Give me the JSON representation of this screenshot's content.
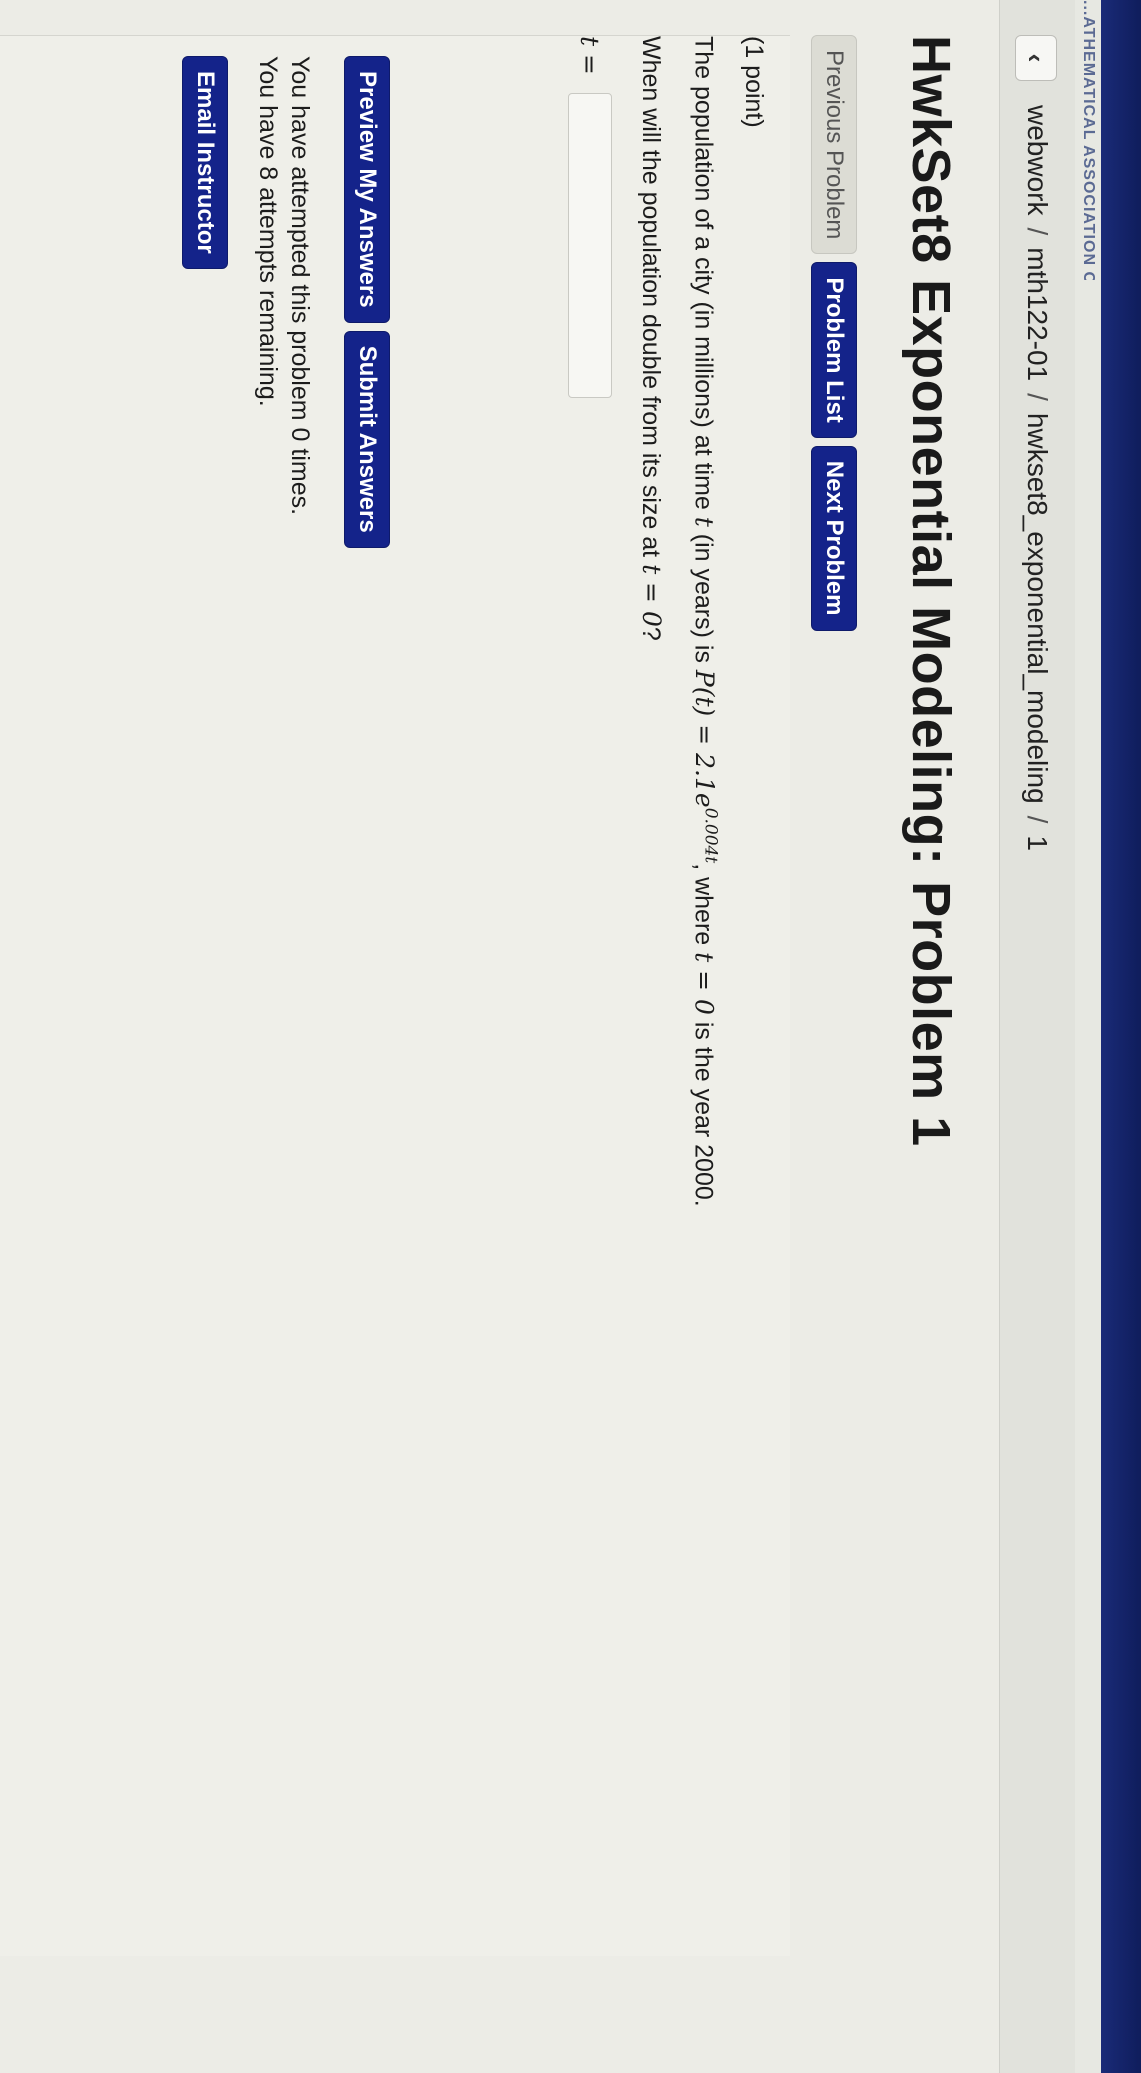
{
  "banner": {
    "text": "...ATHEMATICAL ASSOCIATION OF AMERICA"
  },
  "topbar": {
    "back_icon": "chevron-left-icon",
    "back_glyph": "‹",
    "breadcrumb": [
      "webwork",
      "mth122-01",
      "hwkset8_exponential_modeling",
      "1"
    ],
    "separator": "/"
  },
  "page": {
    "title": "HwkSet8 Exponential Modeling: Problem 1"
  },
  "nav": {
    "previous": "Previous Problem",
    "list": "Problem List",
    "next": "Next Problem"
  },
  "problem": {
    "points": "(1 point)",
    "text_a": "The population of a city (in millions) at time ",
    "var_t": "t",
    "text_b": " (in years) is ",
    "formula_lhs": "P(t) = 2.1e",
    "formula_exp": "0.004t",
    "text_c": ", where ",
    "cond": "t = 0",
    "text_d": " is the year 2000.",
    "prompt_a": "When will the population double from its size at ",
    "prompt_cond": "t = 0",
    "prompt_b": "?",
    "answer_label": "t =",
    "answer_value": ""
  },
  "actions": {
    "preview": "Preview My Answers",
    "submit": "Submit Answers"
  },
  "attempts": {
    "line1": "You have attempted this problem 0 times.",
    "line2": "You have 8 attempts remaining."
  },
  "email": {
    "label": "Email Instructor"
  },
  "colors": {
    "primary": "#14238a",
    "disabled": "#dcdcd4",
    "background": "#ecece6"
  }
}
